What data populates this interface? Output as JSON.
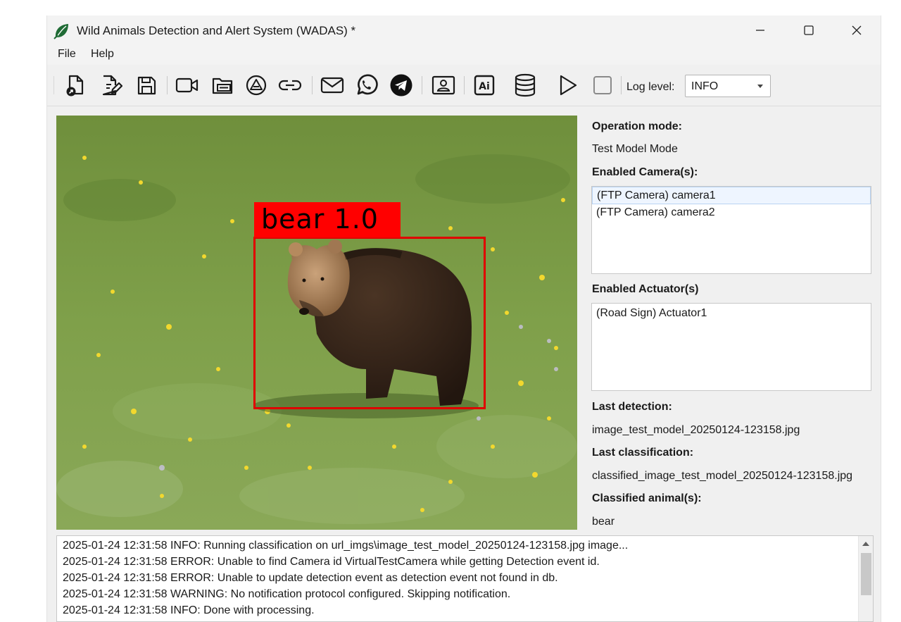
{
  "window": {
    "title": "Wild Animals Detection and Alert System (WADAS) *"
  },
  "menu": [
    "File",
    "Help"
  ],
  "toolbar": {
    "icons": [
      "open-project-icon",
      "edit-file-icon",
      "save-icon",
      "camera-icon",
      "ftp-server-icon",
      "ai-model-icon",
      "link-icon",
      "email-icon",
      "whatsapp-icon",
      "telegram-icon",
      "contact-card-icon",
      "ai-icon",
      "database-icon",
      "play-icon",
      "stop-icon"
    ],
    "log_level_label": "Log level:",
    "log_level_value": "INFO"
  },
  "detection": {
    "label": "bear",
    "score": "1.0"
  },
  "right_panel": {
    "operation_mode_label": "Operation mode:",
    "operation_mode_value": "Test Model Mode",
    "cameras_label": "Enabled Camera(s):",
    "cameras": [
      "(FTP Camera) camera1",
      "(FTP Camera) camera2"
    ],
    "actuators_label": "Enabled Actuator(s)",
    "actuators": [
      "(Road Sign) Actuator1"
    ],
    "last_detection_label": "Last detection:",
    "last_detection_value": "image_test_model_20250124-123158.jpg",
    "last_classification_label": "Last classification:",
    "last_classification_value": "classified_image_test_model_20250124-123158.jpg",
    "classified_animals_label": "Classified animal(s):",
    "classified_animals_value": "bear"
  },
  "log": [
    "2025-01-24 12:31:58 INFO: Running classification on url_imgs\\image_test_model_20250124-123158.jpg image...",
    "2025-01-24 12:31:58 ERROR: Unable to find Camera id VirtualTestCamera while getting Detection event id.",
    "2025-01-24 12:31:58 ERROR: Unable to update detection event as detection event not found in db.",
    "2025-01-24 12:31:58 WARNING: No notification protocol configured. Skipping notification.",
    "2025-01-24 12:31:58 INFO: Done with processing."
  ],
  "colors": {
    "bbox": "#ff0000",
    "app_icon": "#1f6b35"
  }
}
